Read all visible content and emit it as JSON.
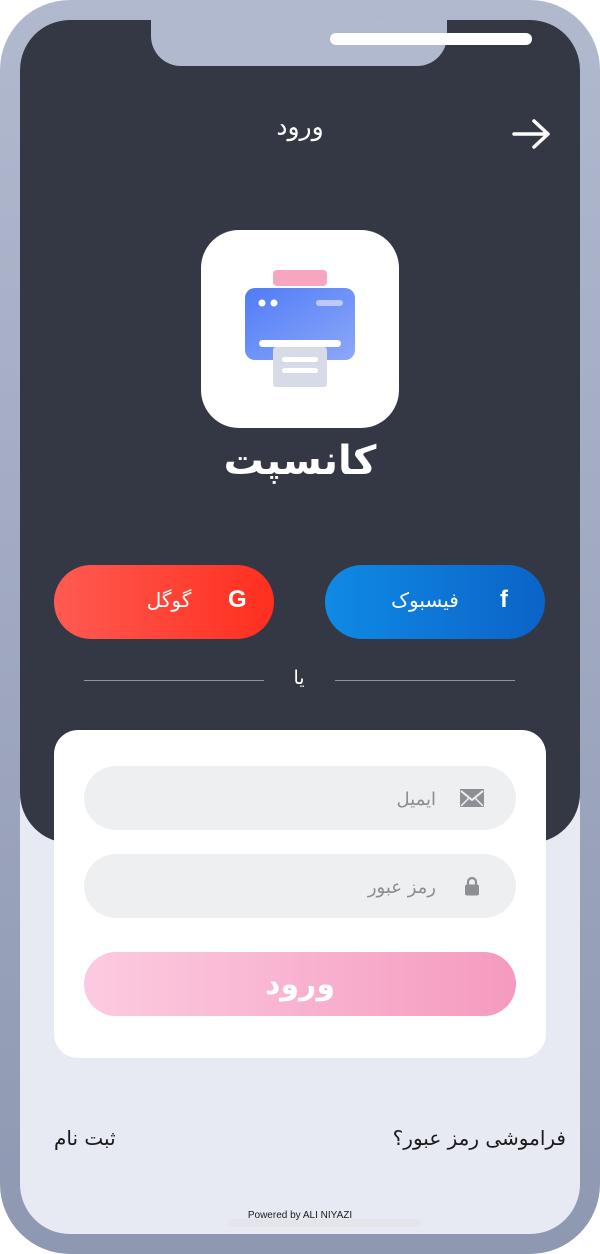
{
  "header": {
    "title": "ورود",
    "back_icon": "arrow-right-icon"
  },
  "app": {
    "name": "کانسپت",
    "icon": "printer-icon"
  },
  "social": {
    "facebook": {
      "label": "فیسبوک",
      "glyph": "f",
      "color": "#0b63c8"
    },
    "google": {
      "label": "گوگل",
      "glyph": "G",
      "color": "#ff3b2f"
    }
  },
  "divider": {
    "text": "یا"
  },
  "form": {
    "email_placeholder": "ایمیل",
    "email_value": "",
    "password_placeholder": "رمز عبور",
    "password_value": "",
    "submit_label": "ورود",
    "email_icon": "envelope-icon",
    "password_icon": "lock-icon"
  },
  "footer": {
    "forgot_password": "فراموشی رمز عبور؟",
    "register": "ثبت نام",
    "powered_by": "Powered by ALI NIYAZI"
  },
  "colors": {
    "dark_background": "#343845",
    "light_background": "#e7eaf3",
    "frame": "#a3abc3",
    "submit_gradient_start": "#fccbe0",
    "submit_gradient_end": "#f59ac0"
  }
}
